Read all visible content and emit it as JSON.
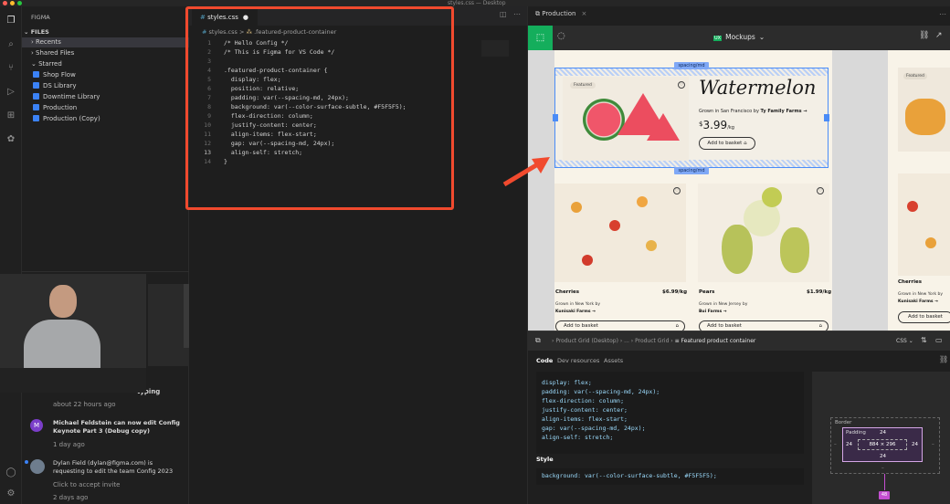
{
  "window": {
    "title": "styles.css — Desktop"
  },
  "sidebar": {
    "header": "FIGMA",
    "files_label": "FILES",
    "recents": "Recents",
    "shared": "Shared Files",
    "starred": "Starred",
    "files": [
      "Shop Flow",
      "DS Library",
      "Downtime Library",
      "Production",
      "Production (Copy)"
    ],
    "notifications": [
      {
        "text": "typing",
        "time": "about 22 hours ago"
      },
      {
        "avatar": "M",
        "text": "Michael Feldstein can now edit Config Keynote Part 3 (Debug copy)",
        "time": "1 day ago"
      },
      {
        "text": "Dylan Field (dylan@figma.com) is requesting to edit the team Config 2023",
        "action": "Click to accept invite",
        "time": "2 days ago"
      }
    ]
  },
  "editor": {
    "tab": "styles.css",
    "breadcrumb_file": "styles.css",
    "breadcrumb_sep": ">",
    "breadcrumb_symbol": ".featured-product-container",
    "lines": [
      {
        "n": "1",
        "t": "/* Hello Config */"
      },
      {
        "n": "2",
        "t": "/* This is Figma for VS Code */"
      },
      {
        "n": "3",
        "t": ""
      },
      {
        "n": "4",
        "t": ".featured-product-container {"
      },
      {
        "n": "5",
        "t": "  display: flex;"
      },
      {
        "n": "6",
        "t": "  position: relative;"
      },
      {
        "n": "7",
        "t": "  padding: var(--spacing-md, 24px);"
      },
      {
        "n": "8",
        "t": "  background: var(--color-surface-subtle, #F5F5F5);"
      },
      {
        "n": "9",
        "t": "  flex-direction: column;"
      },
      {
        "n": "10",
        "t": "  justify-content: center;"
      },
      {
        "n": "11",
        "t": "  align-items: flex-start;"
      },
      {
        "n": "12",
        "t": "  gap: var(--spacing-md, 24px);"
      },
      {
        "n": "13",
        "t": "  align-self: stretch;"
      },
      {
        "n": "14",
        "t": "}"
      }
    ]
  },
  "figma": {
    "tab": "Production",
    "file_name": "Mockups",
    "badge": "UX",
    "canvas": {
      "spacing_top": "spacing/md",
      "spacing_bottom": "spacing/md",
      "featured": {
        "badge": "Featured",
        "name": "Watermelon",
        "origin_prefix": "Grown in San Francisco by",
        "farm": "Ty Family Farms →",
        "price_symbol": "$",
        "price": "3.99",
        "unit": "/kg",
        "button": "Add to basket"
      },
      "products": [
        {
          "name": "Cherries",
          "price": "$6.99/kg",
          "origin": "Grown in New York by",
          "farm": "Kunisaki Farms →",
          "button": "Add to basket"
        },
        {
          "name": "Pears",
          "price": "$1.99/kg",
          "origin": "Grown in New Jersey by",
          "farm": "Bui Farms →",
          "button": "Add to basket"
        }
      ],
      "side_badge": "Featured",
      "side_name": "Cherries",
      "side_origin": "Grown in New York by",
      "side_farm": "Kunisaki Farms →",
      "side_button": "Add to basket"
    },
    "inspect": {
      "breadcrumb": [
        "Product Grid (Desktop)",
        "...",
        "Product Grid"
      ],
      "selected": "Featured product container",
      "lang": "CSS",
      "tabs": [
        "Code",
        "Dev resources",
        "Assets"
      ],
      "code_lines": [
        "display: flex;",
        "padding: var(--spacing-md, 24px);",
        "flex-direction: column;",
        "justify-content: center;",
        "align-items: flex-start;",
        "gap: var(--spacing-md, 24px);",
        "align-self: stretch;"
      ],
      "style_label": "Style",
      "style_line": "background: var(--color-surface-subtle, #F5F5F5);",
      "box": {
        "border": "Border",
        "padding": "Padding",
        "pt": "24",
        "pl": "24",
        "pr": "24",
        "pb": "24",
        "size": "884 × 296",
        "dash": "–",
        "gap": "48"
      }
    }
  }
}
